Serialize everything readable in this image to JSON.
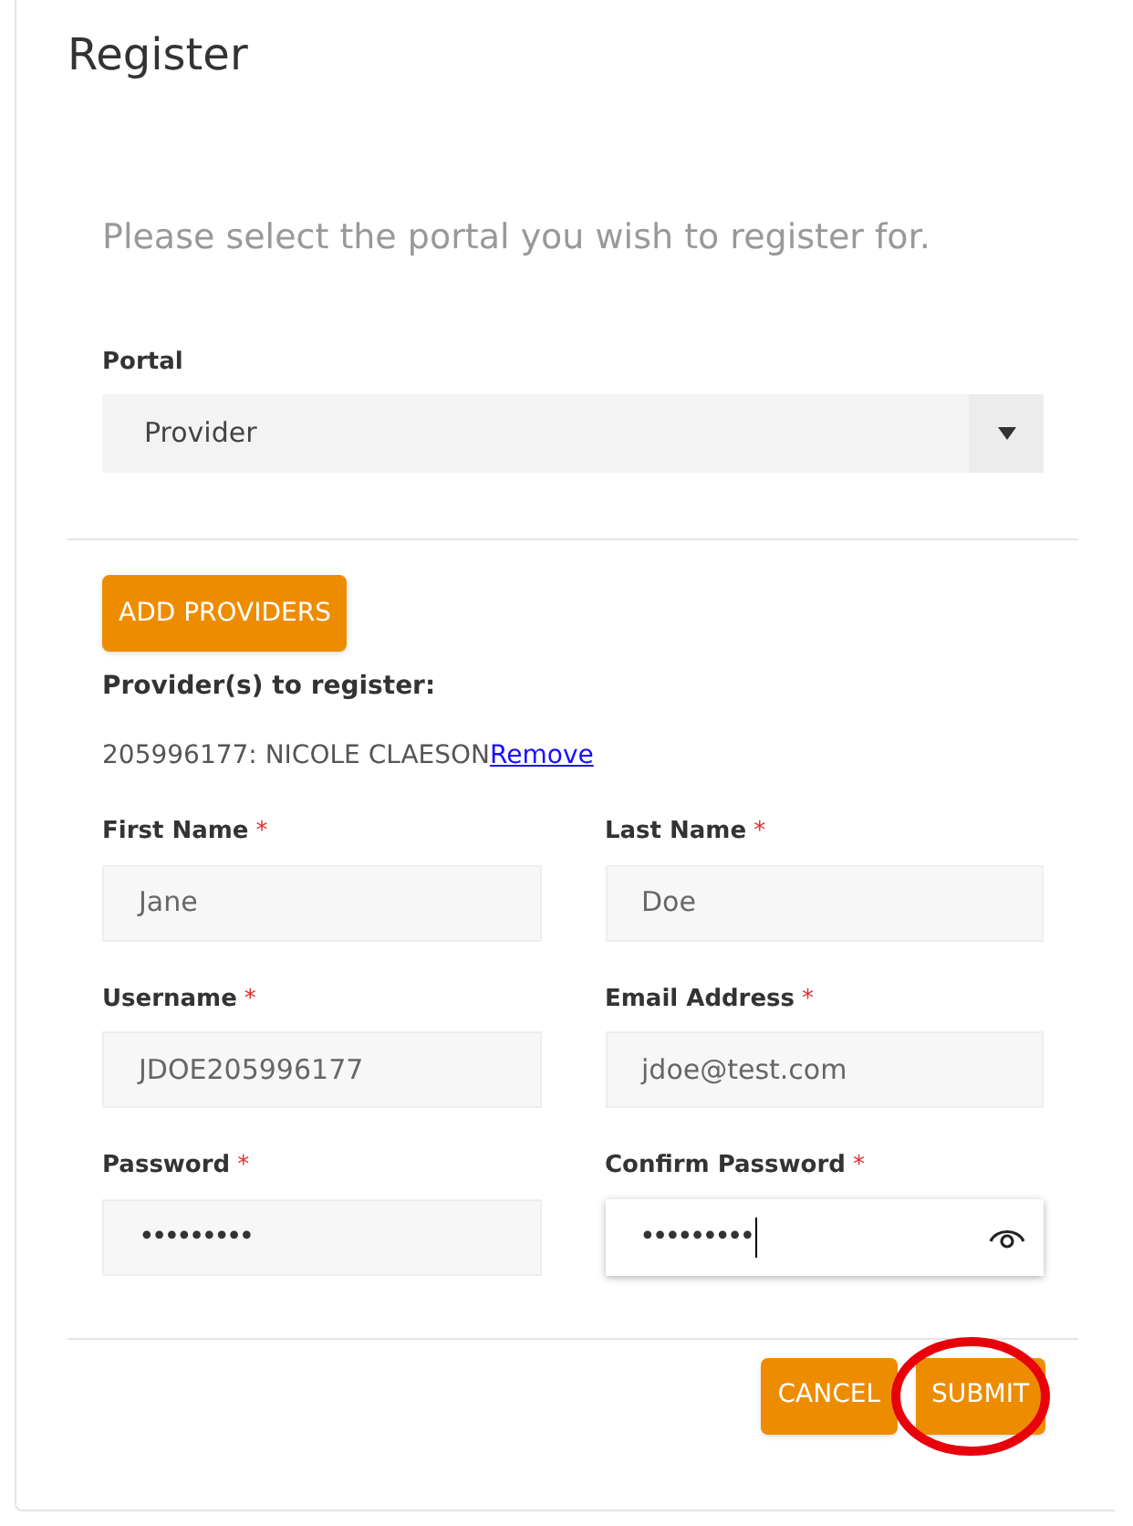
{
  "title": "Register",
  "instruction": "Please select the portal you wish to register for.",
  "portal": {
    "label": "Portal",
    "value": "Provider"
  },
  "add_button": "ADD PROVIDERS",
  "providers_heading": "Provider(s) to register:",
  "providers": [
    {
      "text": "205996177: NICOLE CLAESON",
      "link": "Remove"
    }
  ],
  "fields": [
    {
      "label": "First Name",
      "required_mark": "*",
      "value": "Jane",
      "kind": "text",
      "focused": false
    },
    {
      "label": "Last Name",
      "required_mark": "*",
      "value": "Doe",
      "kind": "text",
      "focused": false
    },
    {
      "label": "Username",
      "required_mark": "*",
      "value": "JDOE205996177",
      "kind": "text",
      "focused": false
    },
    {
      "label": "Email Address",
      "required_mark": "*",
      "value": "jdoe@test.com",
      "kind": "text",
      "focused": false
    },
    {
      "label": "Password",
      "required_mark": "*",
      "value": "•••••••••",
      "kind": "password",
      "focused": false
    },
    {
      "label": "Confirm Password",
      "required_mark": "*",
      "value": "•••••••••",
      "kind": "password",
      "focused": true
    }
  ],
  "buttons": [
    {
      "label": "CANCEL",
      "circled": false
    },
    {
      "label": "SUBMIT",
      "circled": true
    }
  ]
}
